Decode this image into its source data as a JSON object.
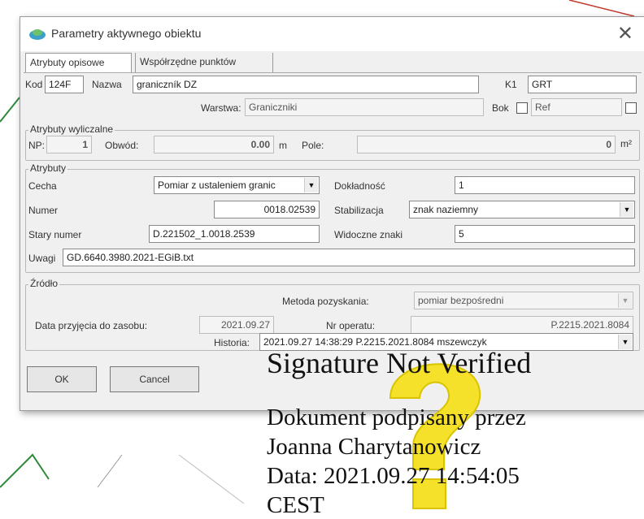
{
  "dialog": {
    "title": "Parametry aktywnego obiektu",
    "close_symbol": "✕",
    "tabs": [
      "Atrybuty opisowe",
      "Współrzędne punktów"
    ]
  },
  "top": {
    "kod_label": "Kod",
    "kod_value": "124F",
    "nazwa_label": "Nazwa",
    "nazwa_value": "graniczník DZ",
    "k1_label": "K1",
    "k1_value": "GRT",
    "warstwa_label": "Warstwa:",
    "warstwa_value": "Graniczniki",
    "bok_label": "Bok",
    "ref_label": "Ref"
  },
  "wyliczalne": {
    "title": "Atrybuty wyliczalne",
    "np_label": "NP:",
    "np_value": "1",
    "obwod_label": "Obwód:",
    "obwod_value": "0.00",
    "obwod_unit": "m",
    "pole_label": "Pole:",
    "pole_value": "0",
    "pole_unit": "m²"
  },
  "atrybuty": {
    "title": "Atrybuty",
    "cecha_label": "Cecha",
    "cecha_value": "Pomiar z ustaleniem granic",
    "dokladnosc_label": "Dokładność",
    "dokladnosc_value": "1",
    "numer_label": "Numer",
    "numer_value": "0018.02539",
    "stabilizacja_label": "Stabilizacja",
    "stabilizacja_value": "znak naziemny",
    "stary_label": "Stary numer",
    "stary_value": "D.221502_1.0018.2539",
    "widoczne_label": "Widoczne znaki",
    "widoczne_value": "5",
    "uwagi_label": "Uwagi",
    "uwagi_value": "GD.6640.3980.2021-EGiB.txt"
  },
  "zrodlo": {
    "title": "Źródło",
    "metoda_label": "Metoda pozyskania:",
    "metoda_value": "pomiar bezpośredni",
    "data_label": "Data przyjęcia do zasobu:",
    "data_value": "2021.09.27",
    "operat_label": "Nr operatu:",
    "operat_value": "P.2215.2021.8084",
    "historia_label": "Historia:",
    "historia_value": "2021.09.27 14:38:29 P.2215.2021.8084 mszewczyk"
  },
  "buttons": {
    "ok": "OK",
    "cancel": "Cancel"
  },
  "signature": {
    "heading": "Signature Not Verified",
    "line1": "Dokument podpisany przez",
    "line2": "Joanna Charytanowicz",
    "line3": "Data: 2021.09.27 14:54:05",
    "line4": "CEST"
  },
  "colors": {
    "question_mark": "#f5e02a",
    "map_line_green": "#2f8a3a",
    "map_line_red": "#c0392b"
  }
}
